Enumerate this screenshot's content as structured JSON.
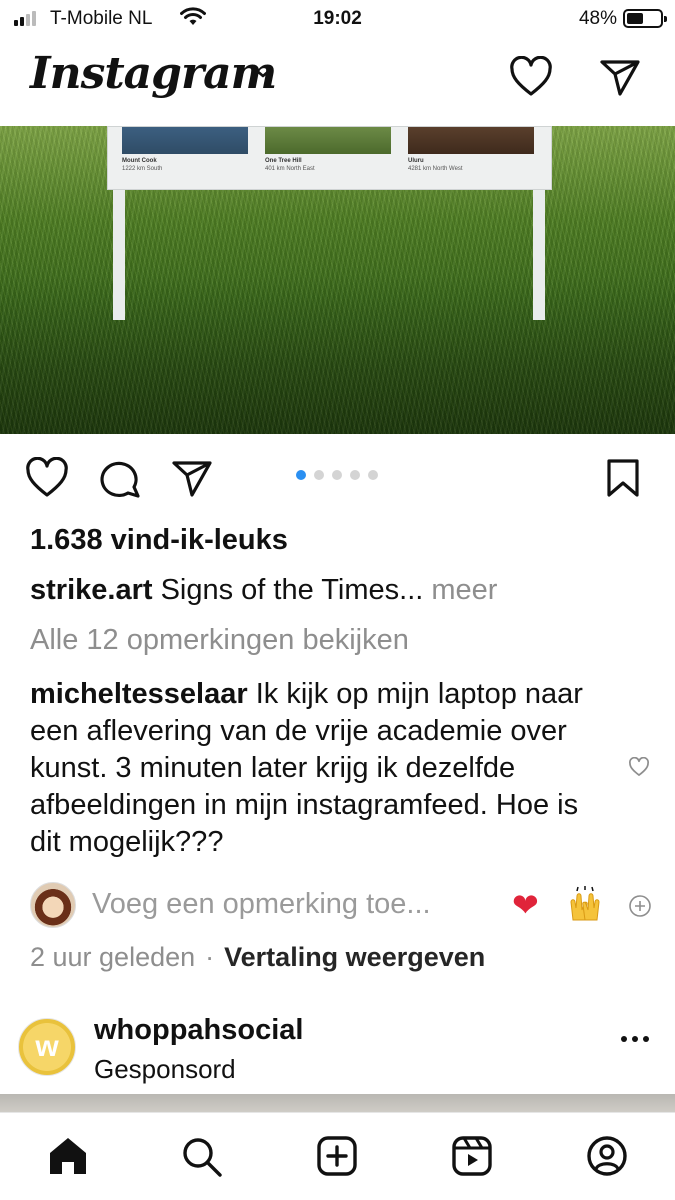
{
  "status_bar": {
    "carrier": "T-Mobile NL",
    "time": "19:02",
    "battery_percent": "48%",
    "battery_level": 0.48,
    "signal_icon": "cellular-signal-icon",
    "wifi_icon": "wifi-icon"
  },
  "header": {
    "logo": "Instagram",
    "icons": [
      "chevron-down-icon",
      "heart-icon",
      "send-icon"
    ]
  },
  "post": {
    "image_sign_captions": [
      {
        "title": "Mount Cook",
        "subtitle": "1222 km South"
      },
      {
        "title": "One Tree Hill",
        "subtitle": "401 km North East"
      },
      {
        "title": "Uluru",
        "subtitle": "4281 km North West"
      }
    ],
    "carousel": {
      "count": 5,
      "active_index": 0
    },
    "likes": "1.638 vind-ik-leuks",
    "caption_user": "strike.art",
    "caption_text": "Signs of the Times...",
    "caption_more": "meer",
    "view_comments": "Alle 12 opmerkingen bekijken",
    "comment": {
      "user": "micheltesselaar",
      "text": "Ik kijk op mijn laptop naar een aflevering van de vrije academie over kunst. 3 minuten later krijg ik dezelfde afbeeldingen in mijn instagramfeed. Hoe is dit mogelijk???"
    },
    "add_comment_placeholder": "Voeg een opmerking toe...",
    "quick_emojis": [
      "❤",
      "🙌"
    ],
    "time_ago": "2 uur geleden",
    "separator": "·",
    "translate_label": "Vertaling weergeven"
  },
  "sponsored": {
    "account": "whoppahsocial",
    "label": "Gesponsord",
    "avatar_letter": "w"
  },
  "tab_bar": {
    "icons": [
      "home-icon",
      "search-icon",
      "create-icon",
      "reels-icon",
      "profile-icon"
    ]
  },
  "colors": {
    "accent": "#2a8ff1",
    "muted_text": "#8e8e8e",
    "like_red": "#e0243a"
  }
}
